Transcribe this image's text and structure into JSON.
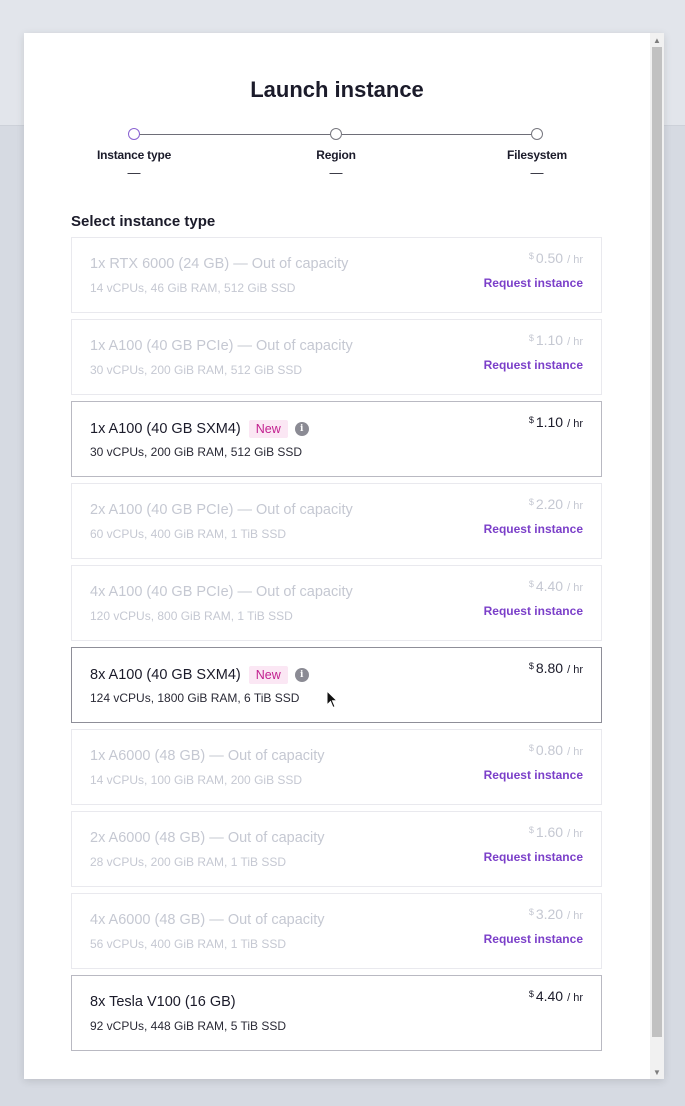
{
  "modal": {
    "title": "Launch instance",
    "steps": [
      {
        "label": "Instance type",
        "value": "—",
        "active": true
      },
      {
        "label": "Region",
        "value": "—",
        "active": false
      },
      {
        "label": "Filesystem",
        "value": "—",
        "active": false
      }
    ],
    "section_heading": "Select instance type"
  },
  "instances": [
    {
      "name": "1x RTX 6000 (24 GB) — Out of capacity",
      "specs": "14 vCPUs, 46 GiB RAM, 512 GiB SSD",
      "currency": "$",
      "price": "0.50",
      "per": "/ hr",
      "available": false,
      "request": "Request instance"
    },
    {
      "name": "1x A100 (40 GB PCIe) — Out of capacity",
      "specs": "30 vCPUs, 200 GiB RAM, 512 GiB SSD",
      "currency": "$",
      "price": "1.10",
      "per": "/ hr",
      "available": false,
      "request": "Request instance"
    },
    {
      "name": "1x A100 (40 GB SXM4)",
      "badge": "New",
      "info_icon": "info-icon",
      "specs": "30 vCPUs, 200 GiB RAM, 512 GiB SSD",
      "currency": "$",
      "price": "1.10",
      "per": "/ hr",
      "available": true
    },
    {
      "name": "2x A100 (40 GB PCIe) — Out of capacity",
      "specs": "60 vCPUs, 400 GiB RAM, 1 TiB SSD",
      "currency": "$",
      "price": "2.20",
      "per": "/ hr",
      "available": false,
      "request": "Request instance"
    },
    {
      "name": "4x A100 (40 GB PCIe) — Out of capacity",
      "specs": "120 vCPUs, 800 GiB RAM, 1 TiB SSD",
      "currency": "$",
      "price": "4.40",
      "per": "/ hr",
      "available": false,
      "request": "Request instance"
    },
    {
      "name": "8x A100 (40 GB SXM4)",
      "badge": "New",
      "info_icon": "info-icon",
      "specs": "124 vCPUs, 1800 GiB RAM, 6 TiB SSD",
      "currency": "$",
      "price": "8.80",
      "per": "/ hr",
      "available": true,
      "hovered": true
    },
    {
      "name": "1x A6000 (48 GB) — Out of capacity",
      "specs": "14 vCPUs, 100 GiB RAM, 200 GiB SSD",
      "currency": "$",
      "price": "0.80",
      "per": "/ hr",
      "available": false,
      "request": "Request instance"
    },
    {
      "name": "2x A6000 (48 GB) — Out of capacity",
      "specs": "28 vCPUs, 200 GiB RAM, 1 TiB SSD",
      "currency": "$",
      "price": "1.60",
      "per": "/ hr",
      "available": false,
      "request": "Request instance"
    },
    {
      "name": "4x A6000 (48 GB) — Out of capacity",
      "specs": "56 vCPUs, 400 GiB RAM, 1 TiB SSD",
      "currency": "$",
      "price": "3.20",
      "per": "/ hr",
      "available": false,
      "request": "Request instance"
    },
    {
      "name": "8x Tesla V100 (16 GB)",
      "specs": "92 vCPUs, 448 GiB RAM, 5 TiB SSD",
      "currency": "$",
      "price": "4.40",
      "per": "/ hr",
      "available": true
    }
  ],
  "colors": {
    "accent": "#7b3fc9",
    "badge_text": "#c21f8f",
    "badge_bg": "#fbe7f4",
    "disabled_text": "#c5c8d2"
  }
}
